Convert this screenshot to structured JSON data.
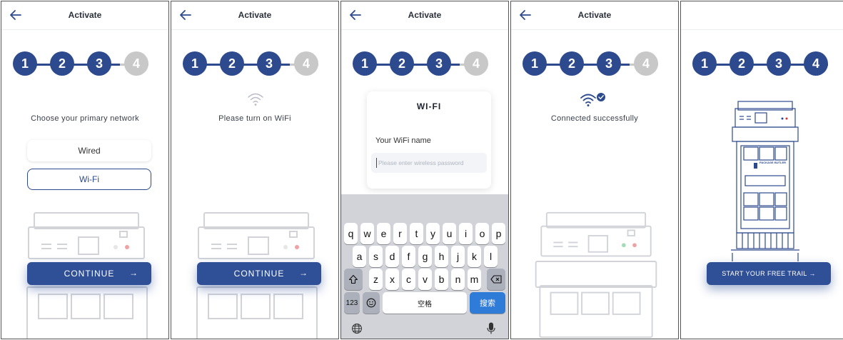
{
  "screen_title": "Activate",
  "steps": [
    "1",
    "2",
    "3",
    "4"
  ],
  "screen1": {
    "prompt": "Choose your primary network",
    "options": [
      "Wired",
      "Wi-Fi"
    ],
    "continue_label": "CONTINUE",
    "arrow": "→"
  },
  "screen2": {
    "prompt": "Please turn on WiFi",
    "continue_label": "CONTINUE",
    "arrow": "→"
  },
  "screen3": {
    "card_title": "WI-FI",
    "field_label": "Your WiFi name",
    "placeholder": "Please enter wireless password",
    "keyboard": {
      "row1": [
        "q",
        "w",
        "e",
        "r",
        "t",
        "y",
        "u",
        "i",
        "o",
        "p"
      ],
      "row2": [
        "a",
        "s",
        "d",
        "f",
        "g",
        "h",
        "j",
        "k",
        "l"
      ],
      "row3": [
        "z",
        "x",
        "c",
        "v",
        "b",
        "n",
        "m"
      ],
      "num_label": "123",
      "space_label": "空格",
      "search_label": "搜索"
    }
  },
  "screen4": {
    "prompt": "Connected successfully"
  },
  "screen5": {
    "cta_label": "START YOUR FREE TRAIL",
    "arrow": "→",
    "brand_text": "PACKAGE BUTLER"
  },
  "colors": {
    "primary": "#2d4a8e",
    "inactive": "#c8c8c8",
    "led_red": "#e03030",
    "led_green": "#2fb55a",
    "key_blue": "#2f7bd8"
  }
}
